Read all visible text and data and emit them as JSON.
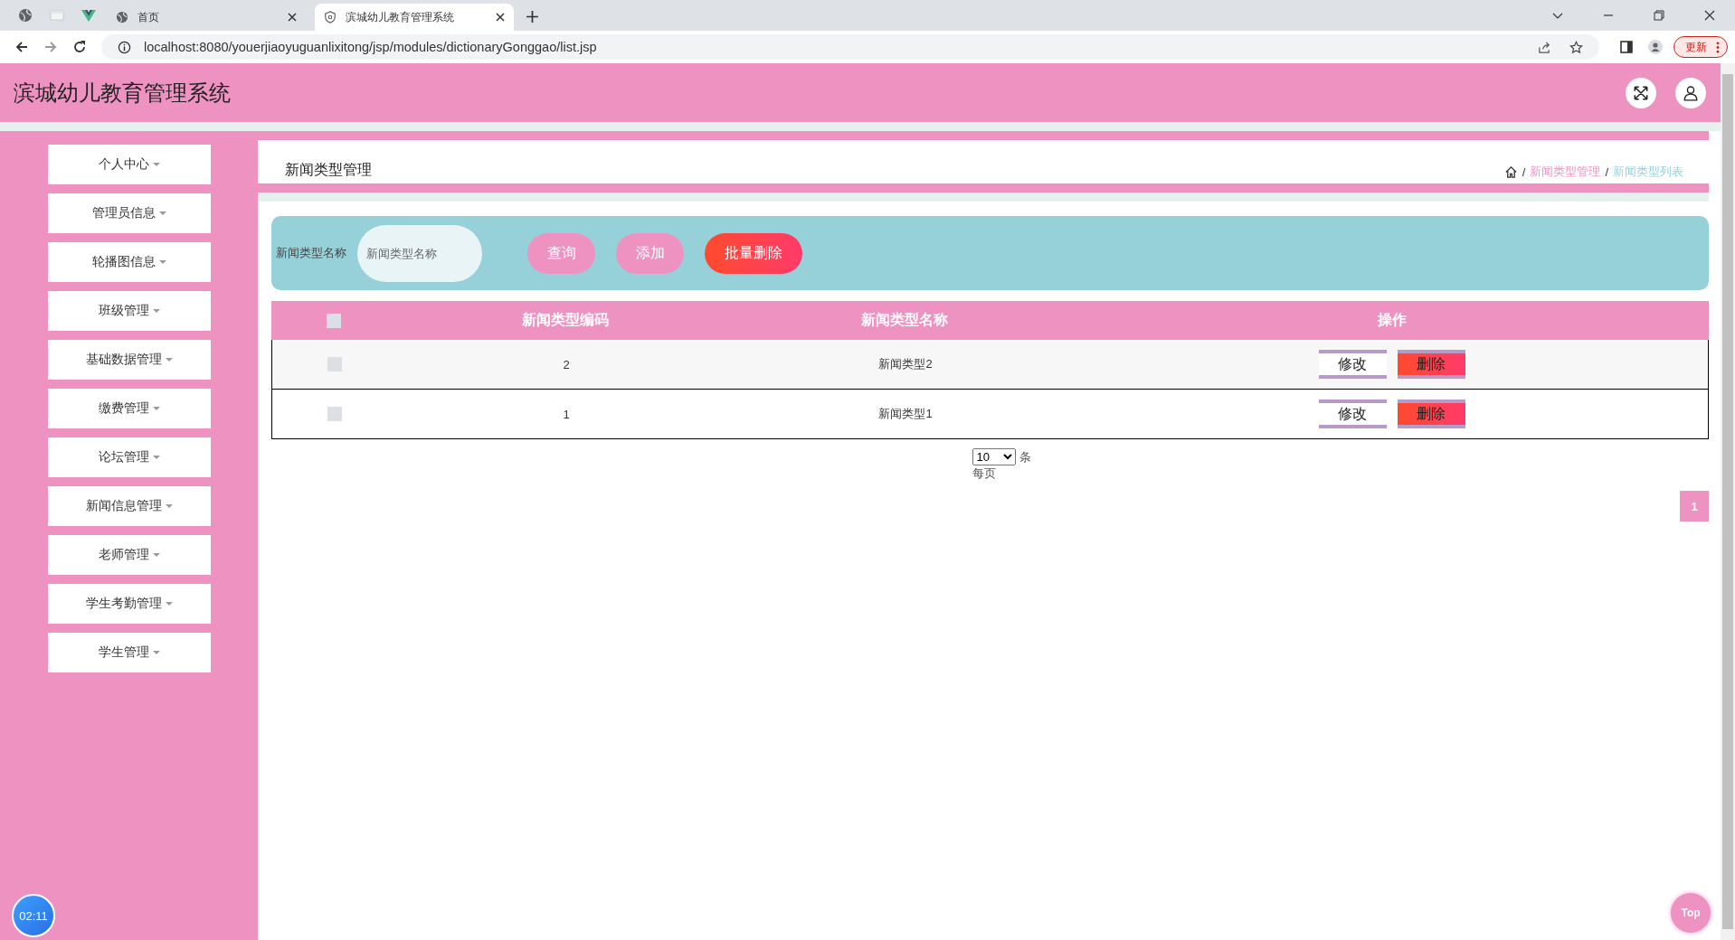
{
  "browser": {
    "tabs": [
      {
        "title": "首页",
        "selected": false
      },
      {
        "title": "滨城幼儿教育管理系统",
        "selected": true
      }
    ],
    "address": "localhost:8080/youerjiaoyuguanlixitong/jsp/modules/dictionaryGonggao/list.jsp",
    "update_button": "更新"
  },
  "app": {
    "title": "滨城幼儿教育管理系统"
  },
  "sidebar": {
    "items": [
      {
        "label": "个人中心"
      },
      {
        "label": "管理员信息"
      },
      {
        "label": "轮播图信息"
      },
      {
        "label": "班级管理"
      },
      {
        "label": "基础数据管理"
      },
      {
        "label": "缴费管理"
      },
      {
        "label": "论坛管理"
      },
      {
        "label": "新闻信息管理"
      },
      {
        "label": "老师管理"
      },
      {
        "label": "学生考勤管理"
      },
      {
        "label": "学生管理"
      }
    ]
  },
  "page": {
    "title": "新闻类型管理",
    "breadcrumb": {
      "separator": "/",
      "items": [
        {
          "label": "新闻类型管理",
          "current": false
        },
        {
          "label": "新闻类型列表",
          "current": true
        }
      ]
    }
  },
  "search": {
    "label": "新闻类型名称",
    "placeholder": "新闻类型名称",
    "buttons": [
      {
        "label": "查询",
        "kind": "query"
      },
      {
        "label": "添加",
        "kind": "add"
      },
      {
        "label": "批量删除",
        "kind": "batch-delete"
      }
    ]
  },
  "table": {
    "select_all": {
      "checked": false
    },
    "columns": [
      "新闻类型编码",
      "新闻类型名称",
      "操作"
    ],
    "rows": [
      {
        "checked": false,
        "code": "2",
        "name": "新闻类型2",
        "actions": [
          {
            "label": "修改",
            "kind": "edit"
          },
          {
            "label": "删除",
            "kind": "delete"
          }
        ]
      },
      {
        "checked": false,
        "code": "1",
        "name": "新闻类型1",
        "actions": [
          {
            "label": "修改",
            "kind": "edit"
          },
          {
            "label": "删除",
            "kind": "delete"
          }
        ]
      }
    ]
  },
  "pagination": {
    "page_size": "10",
    "unit": "条",
    "per_page": "每页",
    "pages": [
      {
        "label": "1",
        "selected": true
      }
    ]
  },
  "clock": "02:11",
  "top_button": "Top"
}
